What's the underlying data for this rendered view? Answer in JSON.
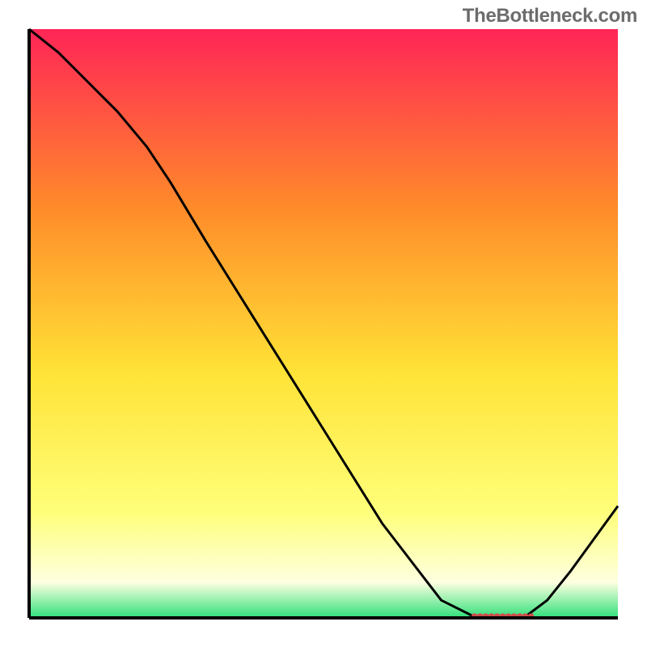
{
  "watermark": "TheBottleneck.com",
  "colors": {
    "top": "#ff2557",
    "mid_upper": "#ff8a2a",
    "mid": "#ffe236",
    "mid_lower": "#ffff7a",
    "pale": "#fdffe0",
    "green": "#2fe07a",
    "curve": "#000000",
    "marker": "#d24a4a",
    "border": "#000000"
  },
  "chart_data": {
    "type": "line",
    "title": "",
    "xlabel": "",
    "ylabel": "",
    "xlim": [
      0,
      100
    ],
    "ylim": [
      0,
      100
    ],
    "grid": false,
    "series": [
      {
        "name": "bottleneck-curve",
        "x": [
          0,
          5,
          10,
          15,
          20,
          24,
          30,
          40,
          50,
          60,
          70,
          76,
          80,
          84,
          88,
          92,
          100
        ],
        "values": [
          100,
          96,
          91,
          86,
          80,
          74,
          64,
          48,
          32,
          16,
          3,
          0,
          0,
          0,
          3,
          8,
          19
        ]
      }
    ],
    "annotations": [
      {
        "name": "optimal-range-marker",
        "type": "segment",
        "x0": 75.5,
        "x1": 86.0,
        "y": 0.4,
        "color": "#d24a4a"
      }
    ],
    "notes": "Values are estimated from pixel positions; axes carry no labels in the source image so x and y are presented on a 0–100 normalized scale. The curve starts at the top-left corner, has a slight knee near x≈24, descends roughly linearly to a flat minimum around x≈76–84, then rises toward the right edge."
  }
}
